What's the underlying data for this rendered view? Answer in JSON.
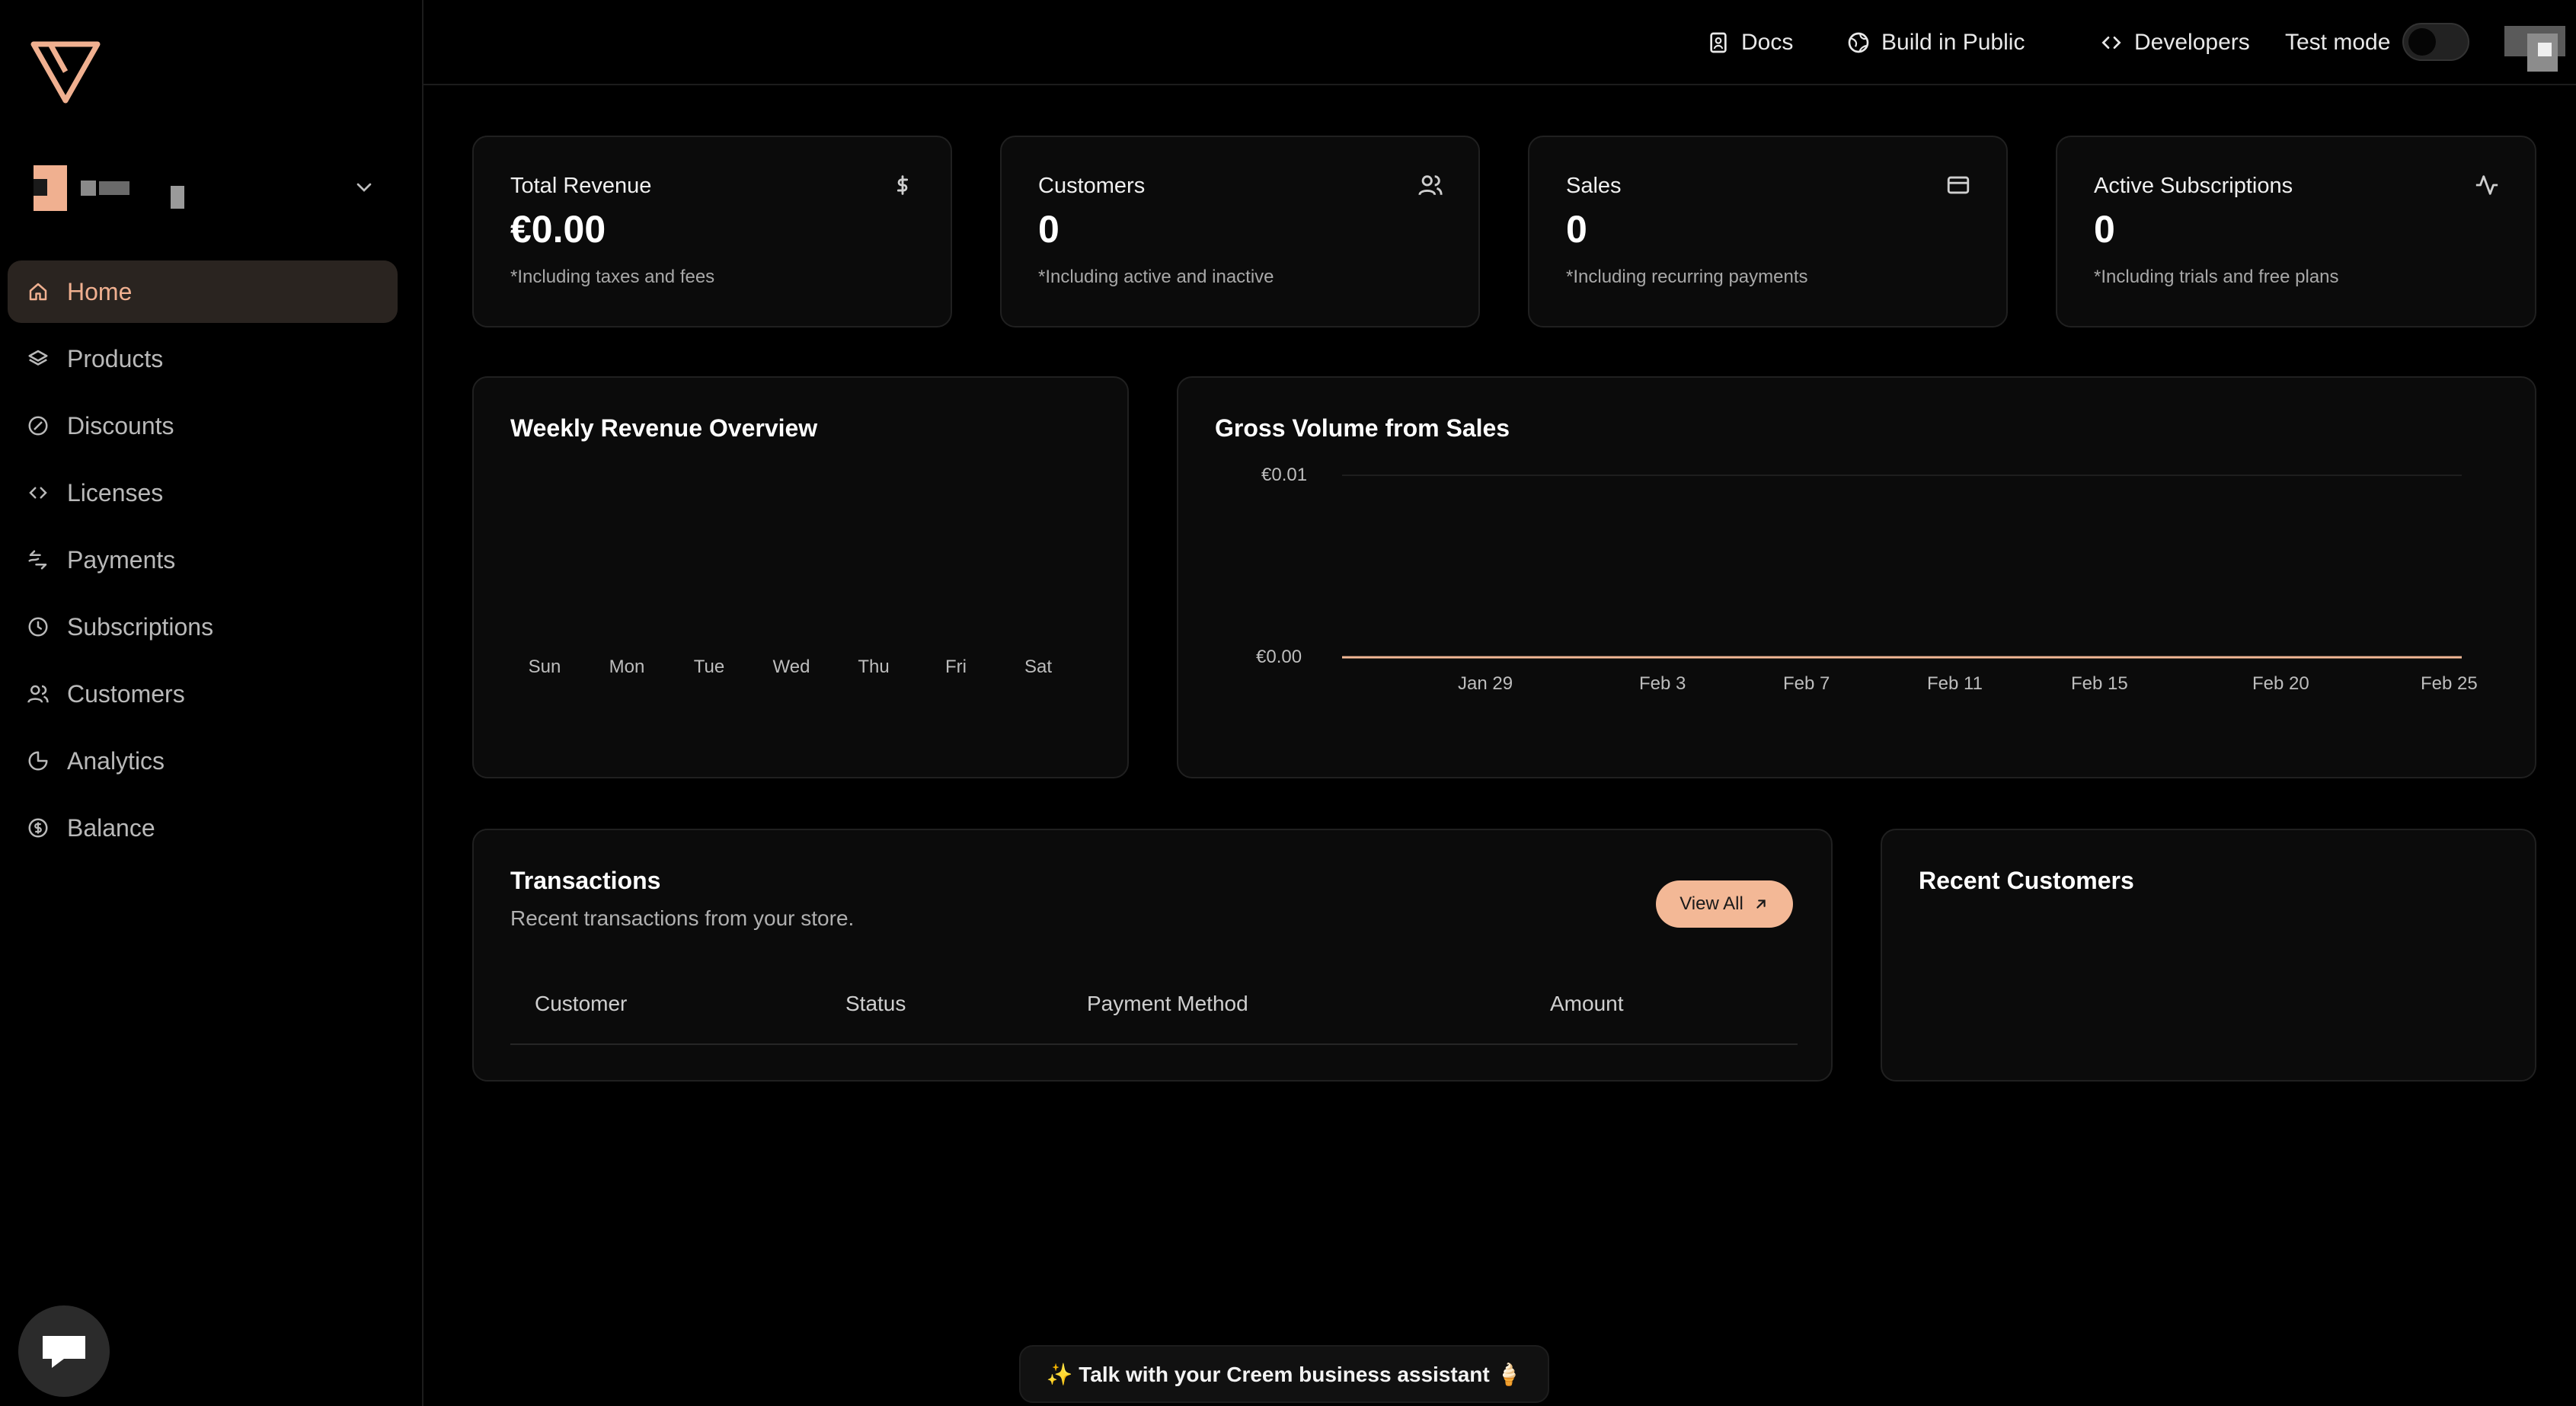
{
  "topbar": {
    "docs": "Docs",
    "build_in_public": "Build in Public",
    "developers": "Developers",
    "test_mode": "Test mode"
  },
  "sidebar": {
    "items": [
      {
        "label": "Home",
        "icon": "home-icon"
      },
      {
        "label": "Products",
        "icon": "layers-icon"
      },
      {
        "label": "Discounts",
        "icon": "discount-icon"
      },
      {
        "label": "Licenses",
        "icon": "code-icon"
      },
      {
        "label": "Payments",
        "icon": "payments-icon"
      },
      {
        "label": "Subscriptions",
        "icon": "clock-icon"
      },
      {
        "label": "Customers",
        "icon": "users-icon"
      },
      {
        "label": "Analytics",
        "icon": "pie-chart-icon"
      },
      {
        "label": "Balance",
        "icon": "dollar-circle-icon"
      }
    ]
  },
  "stats": [
    {
      "title": "Total Revenue",
      "value": "€0.00",
      "sub": "*Including taxes and fees",
      "icon": "dollar-icon"
    },
    {
      "title": "Customers",
      "value": "0",
      "sub": "*Including active and inactive",
      "icon": "users-icon"
    },
    {
      "title": "Sales",
      "value": "0",
      "sub": "*Including recurring payments",
      "icon": "credit-card-icon"
    },
    {
      "title": "Active Subscriptions",
      "value": "0",
      "sub": "*Including trials and free plans",
      "icon": "activity-icon"
    }
  ],
  "weekly": {
    "title": "Weekly Revenue Overview"
  },
  "gross": {
    "title": "Gross Volume from Sales"
  },
  "chart_data": [
    {
      "type": "bar",
      "title": "Weekly Revenue Overview",
      "categories": [
        "Sun",
        "Mon",
        "Tue",
        "Wed",
        "Thu",
        "Fri",
        "Sat"
      ],
      "values": [
        0,
        0,
        0,
        0,
        0,
        0,
        0
      ]
    },
    {
      "type": "line",
      "title": "Gross Volume from Sales",
      "x": [
        "Jan 29",
        "Feb 3",
        "Feb 7",
        "Feb 11",
        "Feb 15",
        "Feb 20",
        "Feb 25"
      ],
      "values": [
        0,
        0,
        0,
        0,
        0,
        0,
        0
      ],
      "ytick_labels": [
        "€0.01",
        "€0.00"
      ],
      "ylim": [
        0,
        0.01
      ],
      "line_color": "#f3b896"
    }
  ],
  "transactions": {
    "title": "Transactions",
    "subtitle": "Recent transactions from your store.",
    "view_all": "View All",
    "columns": [
      "Customer",
      "Status",
      "Payment Method",
      "Amount"
    ]
  },
  "recent_customers": {
    "title": "Recent Customers"
  },
  "assistant": {
    "label": "✨ Talk with your Creem business assistant 🍦"
  },
  "colors": {
    "accent": "#f3b896",
    "background": "#000000",
    "card": "#0b0b0b"
  }
}
